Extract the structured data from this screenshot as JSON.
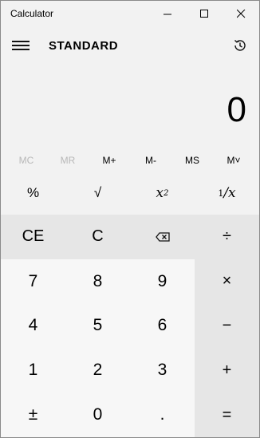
{
  "window": {
    "title": "Calculator",
    "minimize": "─",
    "maximize": "☐",
    "close": "✕"
  },
  "header": {
    "mode": "STANDARD"
  },
  "display": {
    "value": "0"
  },
  "memory": [
    {
      "label": "MC",
      "enabled": false
    },
    {
      "label": "MR",
      "enabled": false
    },
    {
      "label": "M+",
      "enabled": true
    },
    {
      "label": "M-",
      "enabled": true
    },
    {
      "label": "MS",
      "enabled": true
    },
    {
      "label": "M˅",
      "enabled": true
    }
  ],
  "keys": {
    "percent": "%",
    "sqrt": "√",
    "square_base": "x",
    "square_exp": "2",
    "reciprocal_num": "1",
    "reciprocal_den": "/x",
    "ce": "CE",
    "c": "C",
    "divide": "÷",
    "seven": "7",
    "eight": "8",
    "nine": "9",
    "multiply": "×",
    "four": "4",
    "five": "5",
    "six": "6",
    "minus": "−",
    "one": "1",
    "two": "2",
    "three": "3",
    "plus": "+",
    "negate": "±",
    "zero": "0",
    "decimal": ".",
    "equals": "="
  }
}
